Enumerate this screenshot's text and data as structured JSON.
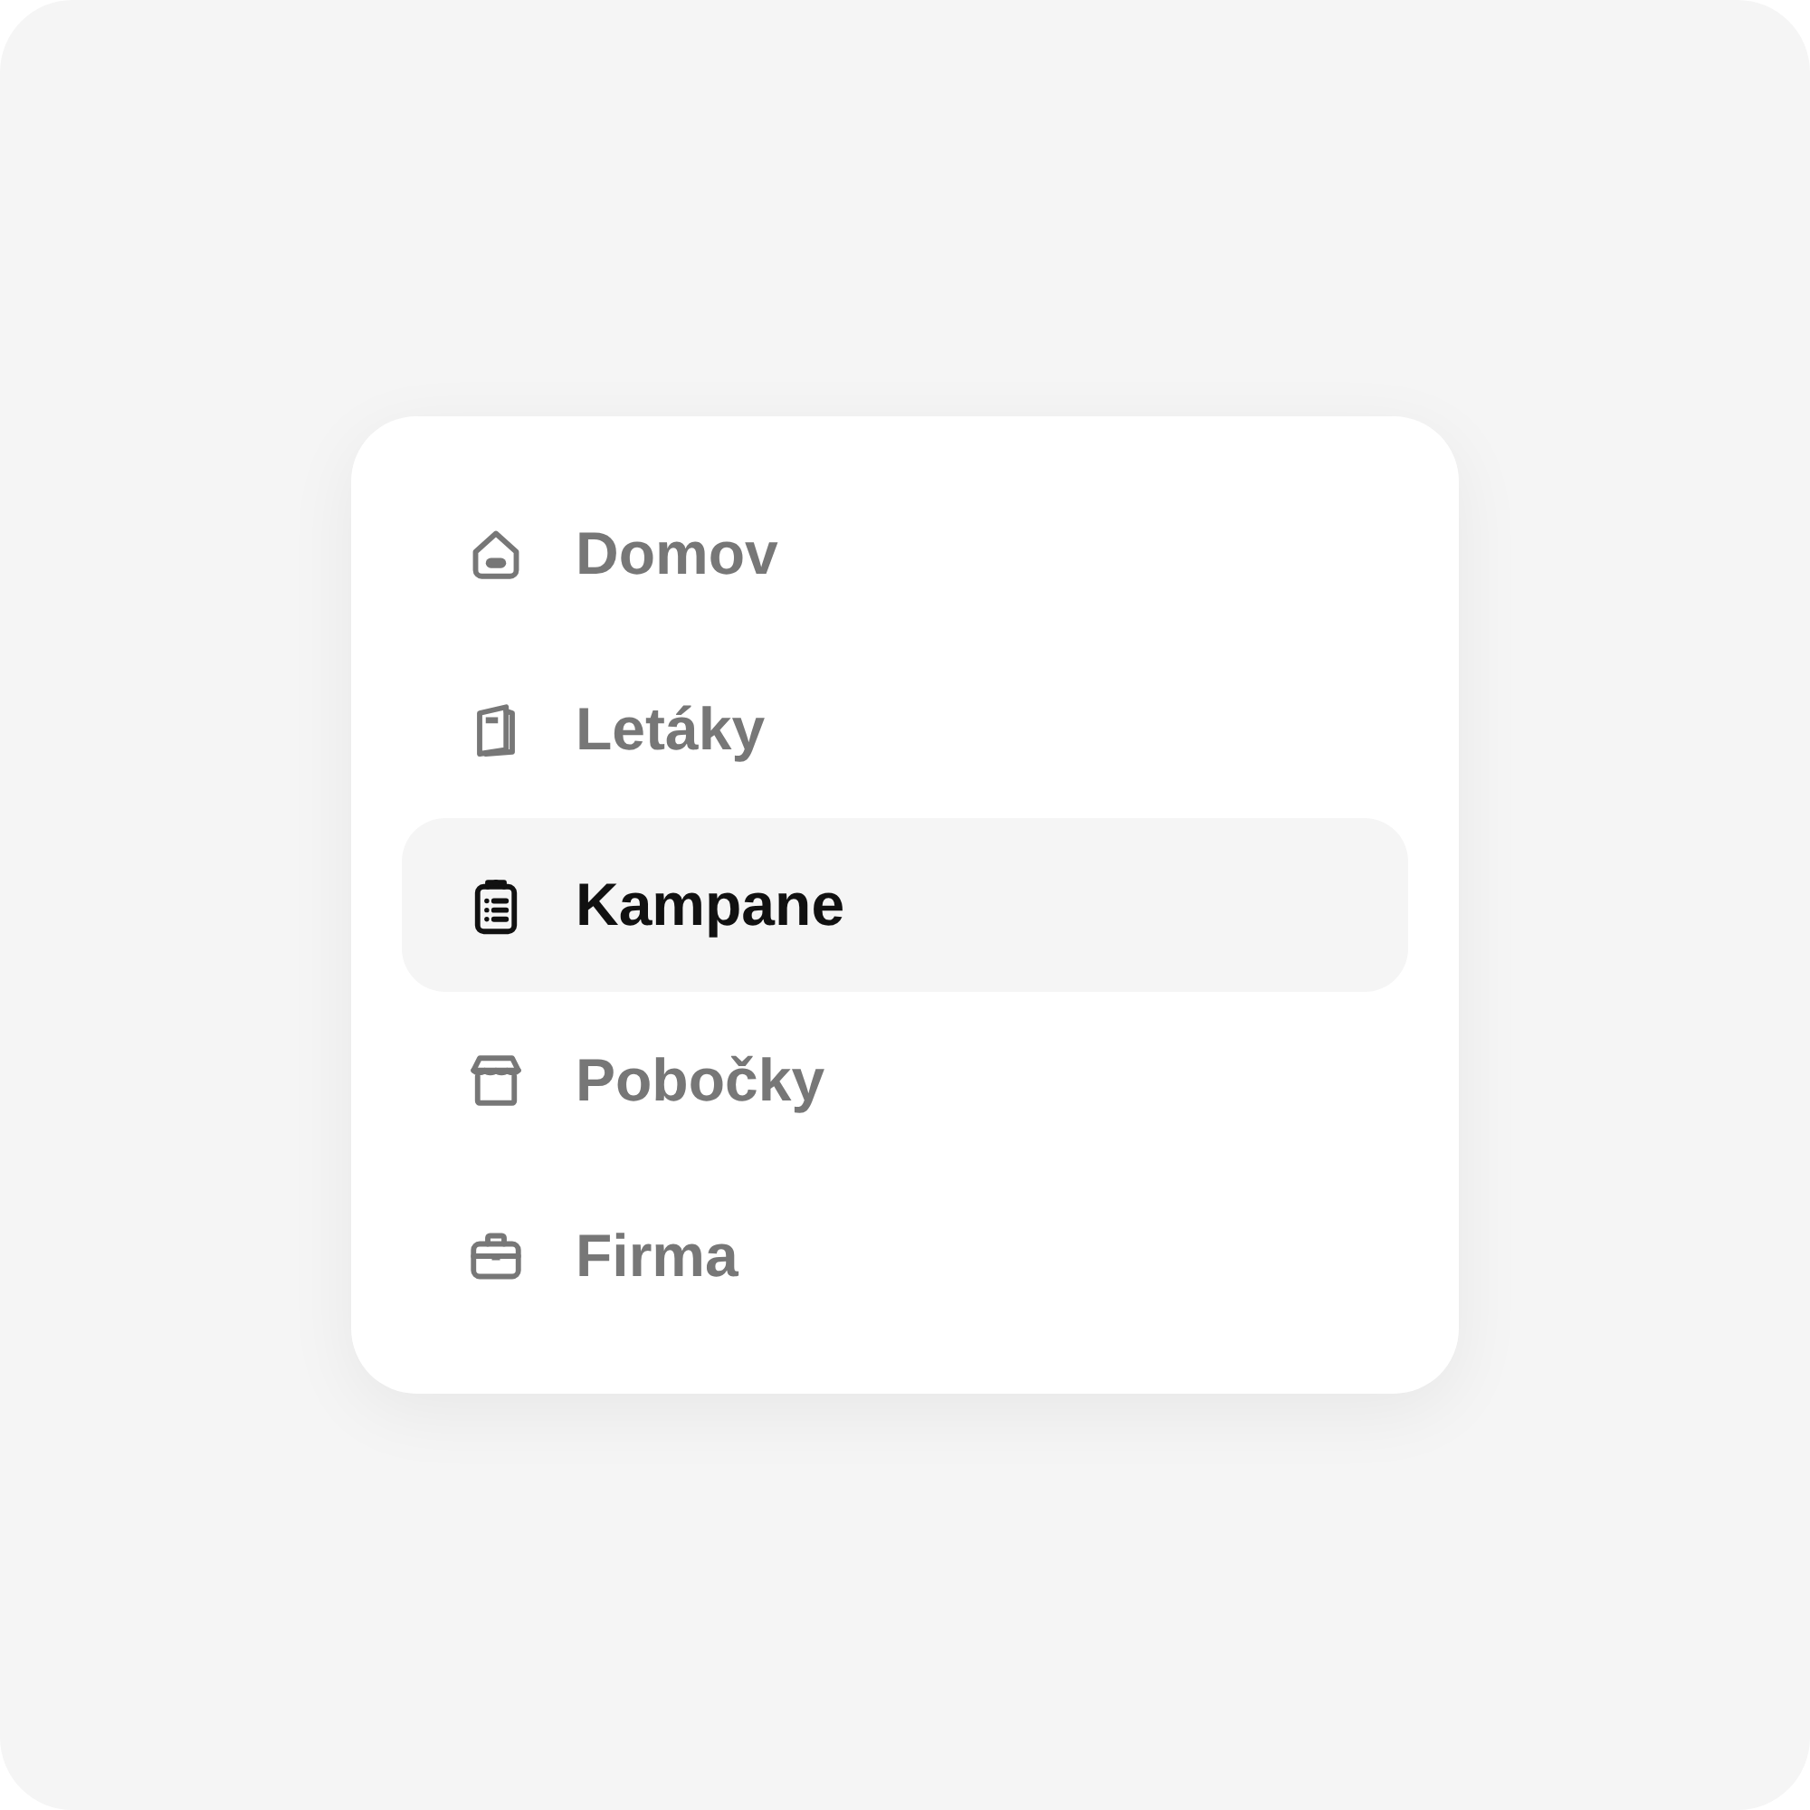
{
  "menu": {
    "items": [
      {
        "label": "Domov",
        "selected": false
      },
      {
        "label": "Letáky",
        "selected": false
      },
      {
        "label": "Kampane",
        "selected": true
      },
      {
        "label": "Pobočky",
        "selected": false
      },
      {
        "label": "Firma",
        "selected": false
      }
    ]
  }
}
